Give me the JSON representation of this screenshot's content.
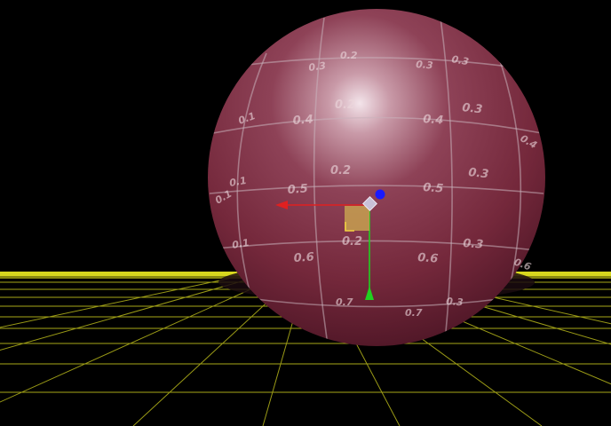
{
  "viewport": {
    "background": "#000000",
    "floor_grid_color": "#b8b820",
    "horizon_color": "#e6e620",
    "sphere_color": "#7a2a3c",
    "sphere_highlight": "#f2e6ea",
    "uv_grid_color": "#c9b3bb"
  },
  "gizmo": {
    "x_axis": {
      "color": "#e02020",
      "icon": "arrow-left-icon"
    },
    "y_axis": {
      "color": "#20d020",
      "icon": "arrow-down-icon"
    },
    "z_axis": {
      "color": "#1a1aff",
      "icon": "circle-handle-icon"
    },
    "center_color": "#c7a050",
    "pivot_icon": "diamond-pivot-icon"
  },
  "uv_labels": [
    "0.2",
    "0.3",
    "0.3",
    "0.3",
    "0.2",
    "0.3",
    "0.1",
    "0.4",
    "0.4",
    "0.4",
    "0.2",
    "0.3",
    "0.1",
    "0.5",
    "0.5",
    "0.1",
    "0.2",
    "0.3",
    "0.1",
    "0.6",
    "0.6",
    "0.6",
    "0.7",
    "0.7",
    "0.3"
  ]
}
